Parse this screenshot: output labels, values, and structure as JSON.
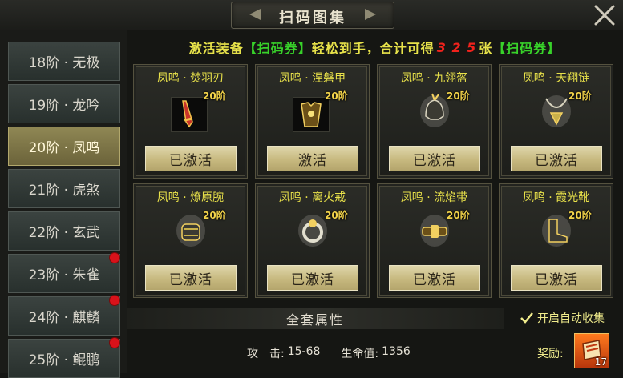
{
  "header": {
    "title": "扫码图集",
    "close_icon": "close-icon"
  },
  "tiers": [
    {
      "label": "18阶 · 无极",
      "active": false,
      "alert": false
    },
    {
      "label": "19阶 · 龙吟",
      "active": false,
      "alert": false
    },
    {
      "label": "20阶 · 凤鸣",
      "active": true,
      "alert": false
    },
    {
      "label": "21阶 · 虎煞",
      "active": false,
      "alert": false
    },
    {
      "label": "22阶 · 玄武",
      "active": false,
      "alert": false
    },
    {
      "label": "23阶 · 朱雀",
      "active": false,
      "alert": true
    },
    {
      "label": "24阶 · 麒麟",
      "active": false,
      "alert": true
    },
    {
      "label": "25阶 · 鲲鹏",
      "active": false,
      "alert": true
    }
  ],
  "banner": {
    "prefix": "激活装备",
    "tag1": "【扫码券】",
    "middle": "轻松到手，合计可得",
    "amount": "3 2 5",
    "unit": "张",
    "tag2": "【扫码券】"
  },
  "cards": [
    {
      "name": "凤鸣 · 焚羽刃",
      "badge": "20阶",
      "button": "已激活",
      "icon": "sword-icon",
      "boxed": true
    },
    {
      "name": "凤鸣 · 涅磐甲",
      "badge": "20阶",
      "button": "激活",
      "icon": "armor-icon",
      "boxed": true
    },
    {
      "name": "凤鸣 · 九翎盔",
      "badge": "20阶",
      "button": "已激活",
      "icon": "helmet-icon",
      "boxed": false
    },
    {
      "name": "凤鸣 · 天翔链",
      "badge": "20阶",
      "button": "已激活",
      "icon": "necklace-icon",
      "boxed": false
    },
    {
      "name": "凤鸣 · 燎原腕",
      "badge": "20阶",
      "button": "已激活",
      "icon": "bracer-icon",
      "boxed": false
    },
    {
      "name": "凤鸣 · 离火戒",
      "badge": "20阶",
      "button": "已激活",
      "icon": "ring-icon",
      "boxed": false
    },
    {
      "name": "凤鸣 · 流焰带",
      "badge": "20阶",
      "button": "已激活",
      "icon": "belt-icon",
      "boxed": false
    },
    {
      "name": "凤鸣 · 霞光靴",
      "badge": "20阶",
      "button": "已激活",
      "icon": "boots-icon",
      "boxed": false
    }
  ],
  "suit": {
    "label": "全套属性"
  },
  "auto_collect": {
    "label": "开启自动收集",
    "checked": true
  },
  "stats": [
    {
      "name": "攻　击:",
      "value": "15-68"
    },
    {
      "name": "生命值:",
      "value": "1356"
    }
  ],
  "reward": {
    "label": "奖励:",
    "count": "17",
    "icon": "reward-scroll-icon"
  },
  "colors": {
    "accent_yellow": "#e7e24a",
    "accent_green": "#38d22a",
    "accent_red": "#f0221c",
    "alert_red": "#d8121a"
  }
}
